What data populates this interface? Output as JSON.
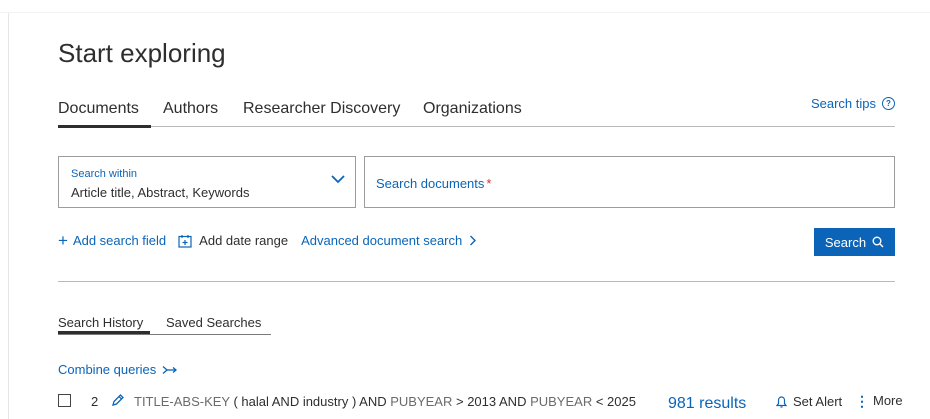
{
  "page": {
    "title": "Start exploring"
  },
  "tabs": [
    {
      "label": "Documents",
      "active": true
    },
    {
      "label": "Authors"
    },
    {
      "label": "Researcher Discovery"
    },
    {
      "label": "Organizations"
    }
  ],
  "search_tips": {
    "label": "Search tips",
    "icon": "help-circle-icon"
  },
  "search_within": {
    "label": "Search within",
    "value": "Article title, Abstract, Keywords"
  },
  "search_docs": {
    "placeholder": "Search documents",
    "required_mark": "*"
  },
  "actions": {
    "add_field": "Add search field",
    "add_date": "Add date range",
    "advanced": "Advanced document search"
  },
  "search_button": {
    "label": "Search",
    "icon": "search-icon"
  },
  "history_tabs": [
    {
      "label": "Search History",
      "active": true
    },
    {
      "label": "Saved Searches"
    }
  ],
  "combine": {
    "label": "Combine queries"
  },
  "history": [
    {
      "number": "2",
      "query_prefix": "TITLE-ABS-KEY",
      "query_mid": " ( halal AND industry ) AND ",
      "year_field_1": "PUBYEAR",
      "op1": " > 2013 AND ",
      "year_field_2": "PUBYEAR",
      "op2": " < 2025",
      "results": "981 results",
      "set_alert": "Set Alert",
      "more": "More"
    }
  ],
  "colors": {
    "accent": "#0b64b8",
    "text": "#2e2e2e",
    "required": "#d0342c"
  }
}
